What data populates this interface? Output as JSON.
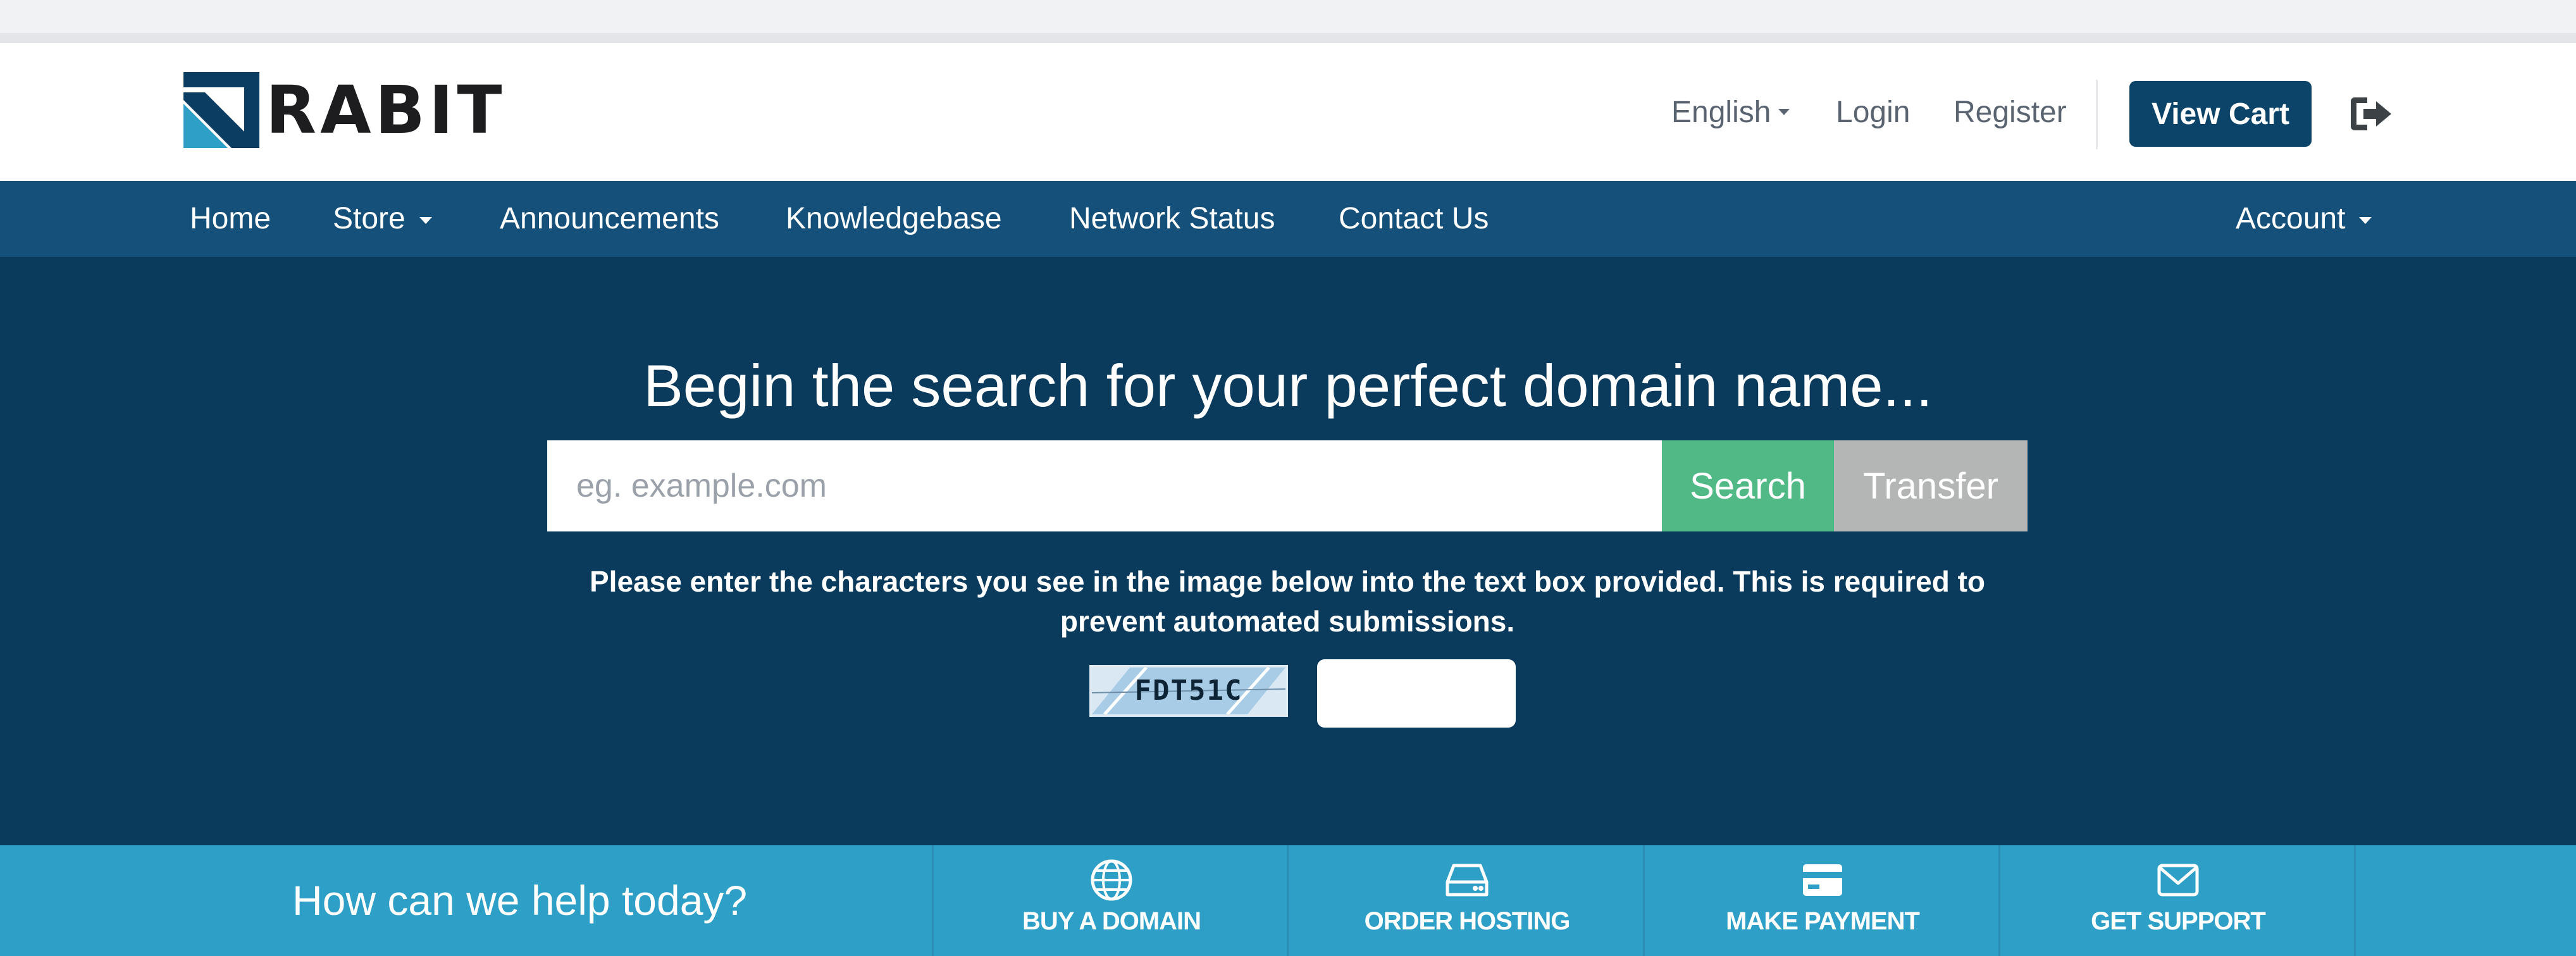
{
  "brand": {
    "name": "RABIT"
  },
  "header": {
    "language": "English",
    "login": "Login",
    "register": "Register",
    "view_cart": "View Cart",
    "logout_icon": "sign-out-icon"
  },
  "nav": {
    "items": [
      {
        "label": "Home"
      },
      {
        "label": "Store"
      },
      {
        "label": "Announcements"
      },
      {
        "label": "Knowledgebase"
      },
      {
        "label": "Network Status"
      },
      {
        "label": "Contact Us"
      }
    ],
    "account": "Account"
  },
  "hero": {
    "title": "Begin the search for your perfect domain name...",
    "search_placeholder": "eg. example.com",
    "search_button": "Search",
    "transfer_button": "Transfer",
    "captcha_prompt": "Please enter the characters you see in the image below into the text box provided. This is required to prevent automated submissions.",
    "captcha_code": "FDT51C"
  },
  "help": {
    "title": "How can we help today?",
    "items": [
      {
        "label": "BUY A DOMAIN",
        "icon": "globe-icon"
      },
      {
        "label": "ORDER HOSTING",
        "icon": "server-icon"
      },
      {
        "label": "MAKE PAYMENT",
        "icon": "credit-card-icon"
      },
      {
        "label": "GET SUPPORT",
        "icon": "envelope-icon"
      }
    ]
  },
  "colors": {
    "navy": "#0a3a5c",
    "nav_blue": "#145079",
    "button_navy": "#0b4468",
    "search_green": "#51b986",
    "transfer_gray": "#b4b5b5",
    "help_cyan": "#2e9fc7"
  }
}
